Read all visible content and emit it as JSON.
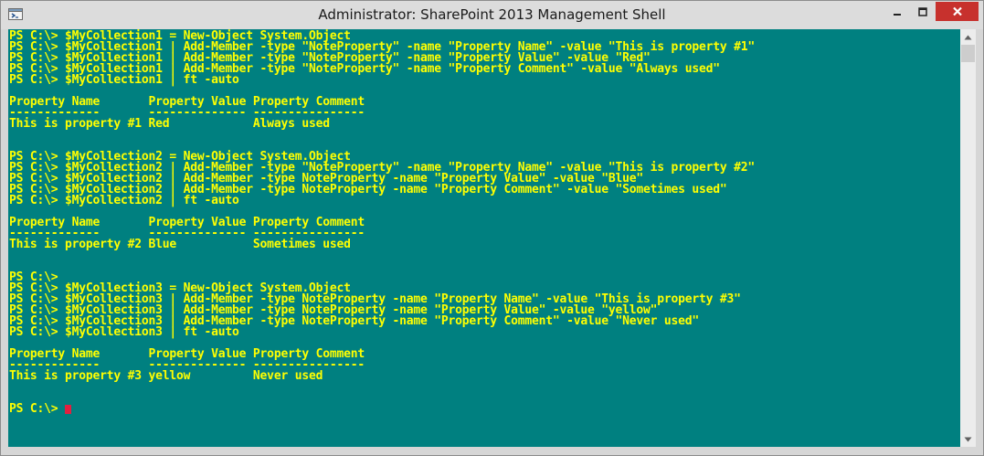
{
  "window": {
    "title": "Administrator: SharePoint 2013 Management Shell",
    "icon": "powershell-icon",
    "buttons": [
      "minimize-icon",
      "maximize-icon",
      "close-icon"
    ]
  },
  "colors": {
    "console_background": "#008080",
    "console_text": "#ffff00",
    "cursor": "#e02040",
    "close_button": "#c7312d"
  },
  "console": {
    "lines": [
      "PS C:\\> $MyCollection1 = New-Object System.Object",
      "PS C:\\> $MyCollection1 | Add-Member -type \"NoteProperty\" -name \"Property Name\" -value \"This is property #1\"",
      "PS C:\\> $MyCollection1 | Add-Member -type \"NoteProperty\" -name \"Property Value\" -value \"Red\"",
      "PS C:\\> $MyCollection1 | Add-Member -type \"NoteProperty\" -name \"Property Comment\" -value \"Always used\"",
      "PS C:\\> $MyCollection1 | ft -auto",
      "",
      "Property Name       Property Value Property Comment",
      "-------------       -------------- ----------------",
      "This is property #1 Red            Always used",
      "",
      "",
      "PS C:\\> $MyCollection2 = New-Object System.Object",
      "PS C:\\> $MyCollection2 | Add-Member -type \"NoteProperty\" -name \"Property Name\" -value \"This is property #2\"",
      "PS C:\\> $MyCollection2 | Add-Member -type NoteProperty -name \"Property Value\" -value \"Blue\"",
      "PS C:\\> $MyCollection2 | Add-Member -type NoteProperty -name \"Property Comment\" -value \"Sometimes used\"",
      "PS C:\\> $MyCollection2 | ft -auto",
      "",
      "Property Name       Property Value Property Comment",
      "-------------       -------------- ----------------",
      "This is property #2 Blue           Sometimes used",
      "",
      "",
      "PS C:\\>",
      "PS C:\\> $MyCollection3 = New-Object System.Object",
      "PS C:\\> $MyCollection3 | Add-Member -type NoteProperty -name \"Property Name\" -value \"This is property #3\"",
      "PS C:\\> $MyCollection3 | Add-Member -type NoteProperty -name \"Property Value\" -value \"yellow\"",
      "PS C:\\> $MyCollection3 | Add-Member -type NoteProperty -name \"Property Comment\" -value \"Never used\"",
      "PS C:\\> $MyCollection3 | ft -auto",
      "",
      "Property Name       Property Value Property Comment",
      "-------------       -------------- ----------------",
      "This is property #3 yellow         Never used",
      "",
      "",
      "PS C:\\> "
    ],
    "cursor_after_last_line": true
  },
  "scrollbar": {
    "up_icon": "triangle-up-icon",
    "down_icon": "triangle-down-icon"
  }
}
